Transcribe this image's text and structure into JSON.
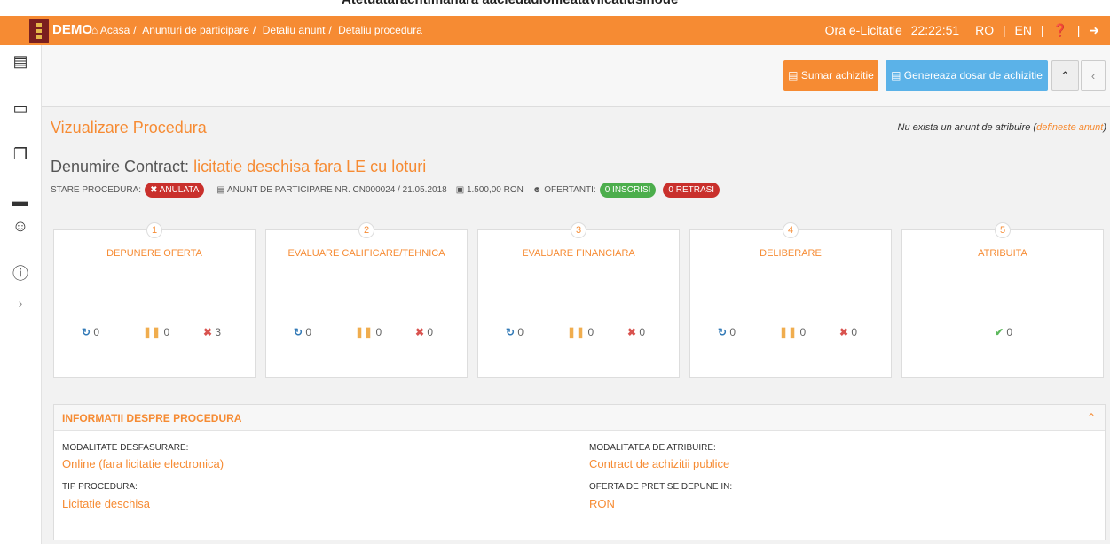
{
  "top_strip": "Atetuatarachtimanara aaciedadionleataviicatlusinoue",
  "header": {
    "brand": "DEMO",
    "breadcrumbs": [
      "Acasa",
      "Anunturi de participare",
      "Detaliu anunt",
      "Detaliu procedura"
    ],
    "time_label": "Ora e-Licitatie",
    "time_value": "22:22:51",
    "lang_ro": "RO",
    "lang_en": "EN"
  },
  "sidebar_icons": [
    "document-icon",
    "export-icon",
    "copy-icon",
    "clipboard-icon",
    "user-icon",
    "alert-icon",
    "chevron-right-icon"
  ],
  "toolbar": {
    "sumar": "Sumar achizitie",
    "genereaza": "Genereaza dosar de achizitie"
  },
  "procedure": {
    "title": "Vizualizare Procedura",
    "no_anunt_text": "Nu exista un anunt de atribuire (",
    "no_anunt_link": "defineste anunt",
    "no_anunt_end": ")",
    "contract_label": "Denumire Contract:",
    "contract_value": "licitatie deschisa fara LE cu loturi",
    "stare_label": "STARE PROCEDURA:",
    "stare_value": "ANULATA",
    "anunt": "ANUNT DE PARTICIPARE NR. CN000024 / 21.05.2018",
    "valoare": "1.500,00 RON",
    "ofertanti_label": "OFERTANTI:",
    "inscrisi": "0 INSCRISI",
    "retrasi": "0 RETRASI"
  },
  "steps": [
    {
      "num": "1",
      "name": "DEPUNERE OFERTA",
      "a": "0",
      "b": "0",
      "c": "3"
    },
    {
      "num": "2",
      "name": "EVALUARE CALIFICARE/TEHNICA",
      "a": "0",
      "b": "0",
      "c": "0"
    },
    {
      "num": "3",
      "name": "EVALUARE FINANCIARA",
      "a": "0",
      "b": "0",
      "c": "0"
    },
    {
      "num": "4",
      "name": "DELIBERARE",
      "a": "0",
      "b": "0",
      "c": "0"
    },
    {
      "num": "5",
      "name": "ATRIBUITA",
      "ok": "0"
    }
  ],
  "info": {
    "title": "INFORMATII DESPRE PROCEDURA",
    "modalitate_label": "MODALITATE DESFASURARE:",
    "modalitate_value": "Online (fara licitatie electronica)",
    "tip_label": "TIP PROCEDURA:",
    "tip_value": "Licitatie deschisa",
    "atribuire_label": "MODALITATEA DE ATRIBUIRE:",
    "atribuire_value": "Contract de achizitii publice",
    "oferta_label": "OFERTA DE PRET SE DEPUNE IN:",
    "oferta_value": "RON"
  }
}
